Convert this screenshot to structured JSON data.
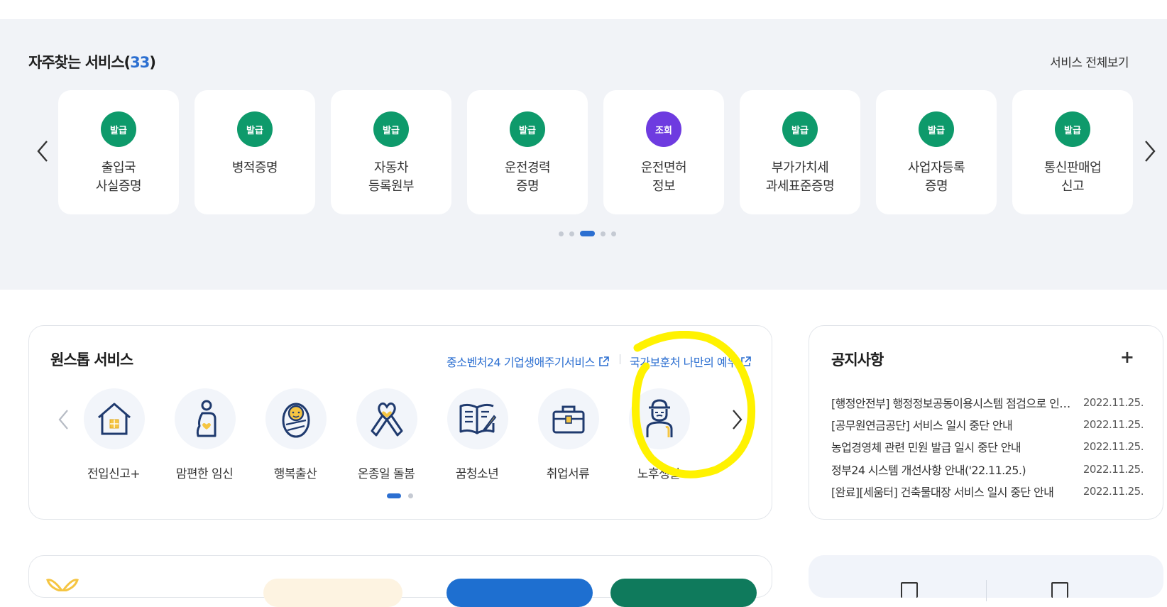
{
  "frequent": {
    "title": "자주찾는 서비스(",
    "count": "33",
    "title_close": ")",
    "view_all": "서비스 전체보기",
    "cards": [
      {
        "badge": "발급",
        "line1": "출입국",
        "line2": "사실증명",
        "badge_color": "#0e9a6b"
      },
      {
        "badge": "발급",
        "line1": "병적증명",
        "line2": "",
        "badge_color": "#0e9a6b"
      },
      {
        "badge": "발급",
        "line1": "자동차",
        "line2": "등록원부",
        "badge_color": "#0e9a6b"
      },
      {
        "badge": "발급",
        "line1": "운전경력",
        "line2": "증명",
        "badge_color": "#0e9a6b"
      },
      {
        "badge": "조회",
        "line1": "운전면허",
        "line2": "정보",
        "badge_color": "#6e3be0"
      },
      {
        "badge": "발급",
        "line1": "부가가치세",
        "line2": "과세표준증명",
        "badge_color": "#0e9a6b"
      },
      {
        "badge": "발급",
        "line1": "사업자등록",
        "line2": "증명",
        "badge_color": "#0e9a6b"
      },
      {
        "badge": "발급",
        "line1": "통신판매업",
        "line2": "신고",
        "badge_color": "#0e9a6b"
      }
    ],
    "pagination": {
      "total": 5,
      "active_index": 2
    }
  },
  "onestop": {
    "title": "원스톱 서비스",
    "link1": "중소벤처24 기업생애주기서비스",
    "link2": "국가보훈처 나만의 예우",
    "services": [
      {
        "label": "전입신고+",
        "icon": "house-icon"
      },
      {
        "label": "맘편한 임신",
        "icon": "pregnancy-icon"
      },
      {
        "label": "행복출산",
        "icon": "baby-icon"
      },
      {
        "label": "온종일 돌봄",
        "icon": "ribbon-heart-icon"
      },
      {
        "label": "꿈청소년",
        "icon": "book-pen-icon"
      },
      {
        "label": "취업서류",
        "icon": "briefcase-icon"
      },
      {
        "label": "노후생활",
        "icon": "elder-icon"
      }
    ],
    "pagination": {
      "total": 2,
      "active_index": 0
    }
  },
  "notice": {
    "title": "공지사항",
    "more": "+",
    "items": [
      {
        "text": "[행정안전부] 행정정보공동이용시스템 점검으로 인한 서비스 일시 중단 안내",
        "date": "2022.11.25."
      },
      {
        "text": "[공무원연금공단] 서비스 일시 중단 안내",
        "date": "2022.11.25."
      },
      {
        "text": "농업경영체 관련 민원 발급 일시 중단 안내",
        "date": "2022.11.25."
      },
      {
        "text": "정부24 시스템 개선사항 안내('22.11.25.)",
        "date": "2022.11.25."
      },
      {
        "text": "[완료][세움터] 건축물대장 서비스 일시 중단 안내",
        "date": "2022.11.25."
      }
    ]
  },
  "colors": {
    "accent": "#2c6fd1",
    "issue_badge": "#0e9a6b",
    "lookup_badge": "#6e3be0",
    "icon_navy": "#1f3a6e",
    "icon_yellow": "#f5c542",
    "annotation": "#fff200"
  }
}
